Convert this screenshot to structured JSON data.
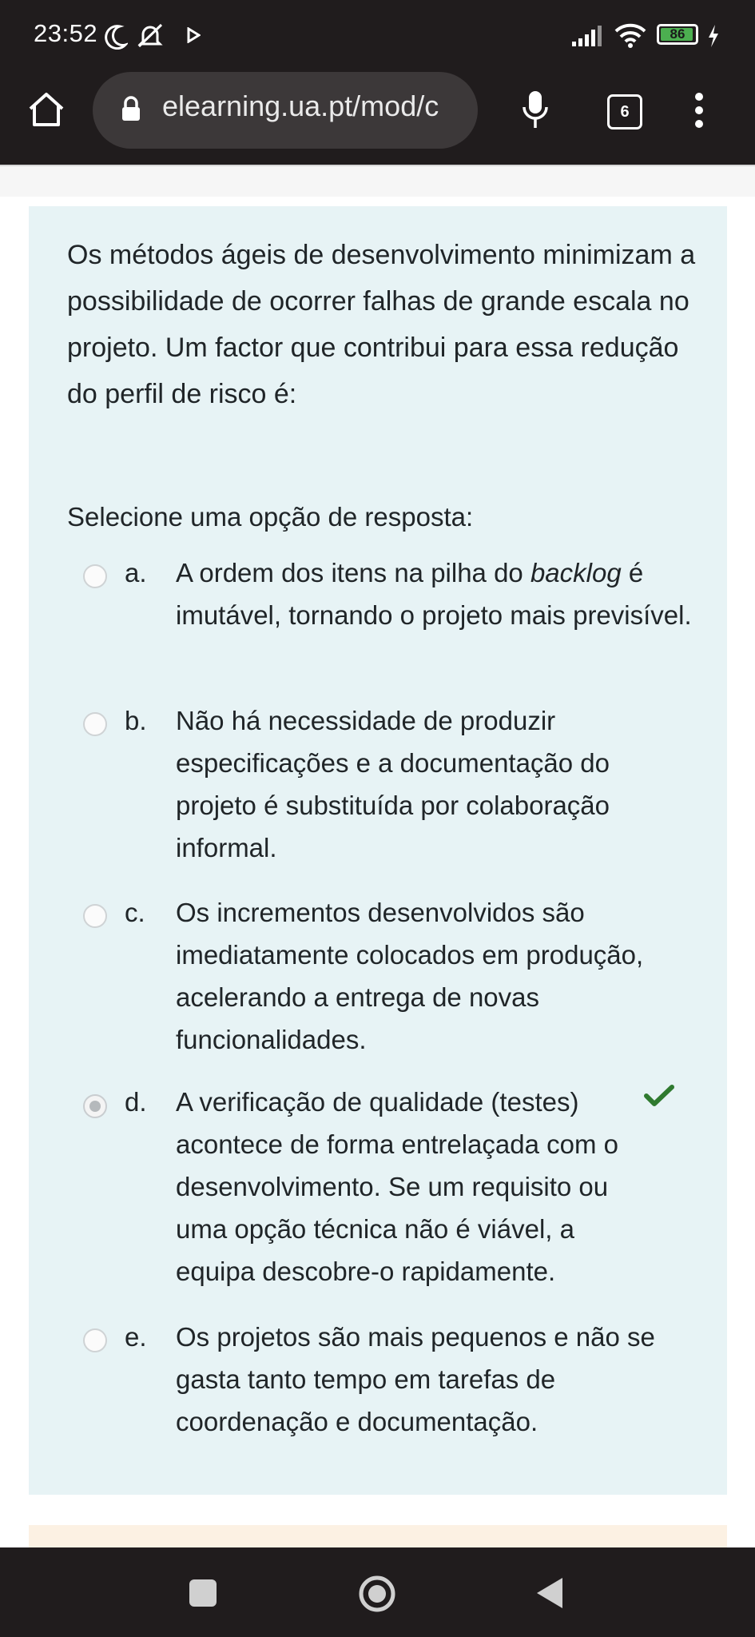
{
  "status_bar": {
    "time": "23:52",
    "battery": "86",
    "icons": [
      "moon-icon",
      "muted-bell-icon",
      "play-icon",
      "signal-icon",
      "wifi-icon",
      "battery-icon",
      "charging-icon"
    ]
  },
  "browser": {
    "url": "elearning.ua.pt/mod/c",
    "tab_count": "6",
    "icons": [
      "home-icon",
      "lock-icon",
      "mic-icon",
      "tabs-icon",
      "menu-icon"
    ]
  },
  "question": {
    "text": "Os métodos ágeis de desenvolvimento minimizam a possibilidade de ocorrer falhas de grande escala no projeto. Um factor que contribui para essa redução do perfil de risco é:",
    "prompt": "Selecione uma opção de resposta:",
    "options": [
      {
        "letter": "a.",
        "text_before": "A ordem dos itens na pilha do ",
        "italic": "backlog",
        "text_after": " é imutável, tornando o projeto mais previsível.",
        "selected": false
      },
      {
        "letter": "b.",
        "text": "Não há necessidade de produzir especificações e a documentação do projeto é substituída por colaboração informal.",
        "selected": false
      },
      {
        "letter": "c.",
        "text": "Os incrementos desenvolvidos são imediatamente colocados em produção, acelerando a entrega de novas funcionalidades.",
        "selected": false
      },
      {
        "letter": "d.",
        "text": "A verificação de qualidade (testes) acontece de forma entrelaçada com o desenvolvimento. Se um requisito ou uma opção técnica não é viável, a equipa descobre-o rapidamente.",
        "selected": true,
        "correct": true
      },
      {
        "letter": "e.",
        "text": "Os projetos são mais pequenos e não se gasta tanto tempo em tarefas de coordenação e documentação.",
        "selected": false
      }
    ]
  },
  "colors": {
    "card_bg": "#e7f3f5",
    "check_green": "#2f7a2f",
    "bar_bg": "#201c1d"
  },
  "nav": {
    "icons": [
      "recents-square-icon",
      "home-circle-icon",
      "back-triangle-icon"
    ]
  }
}
